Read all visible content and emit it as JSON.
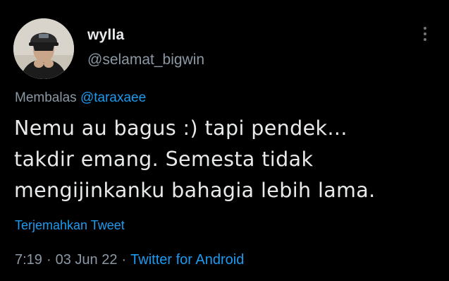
{
  "user": {
    "display_name": "wylla",
    "handle": "@selamat_bigwin"
  },
  "reply": {
    "prefix": "Membalas",
    "mention": "@taraxaee"
  },
  "tweet": {
    "lines": [
      "Nemu au bagus :) tapi pendek...",
      "takdir emang. Semesta tidak",
      "mengijinkanku bahagia lebih lama."
    ]
  },
  "translate_label": "Terjemahkan Tweet",
  "meta": {
    "time": "7:19",
    "separator": "·",
    "date": "03 Jun 22",
    "source": "Twitter for Android"
  },
  "colors": {
    "background": "#000000",
    "text": "#e7e9ea",
    "secondary": "#8b98a5",
    "link": "#1d9bf0"
  },
  "icons": {
    "more": "more-vertical-icon"
  }
}
